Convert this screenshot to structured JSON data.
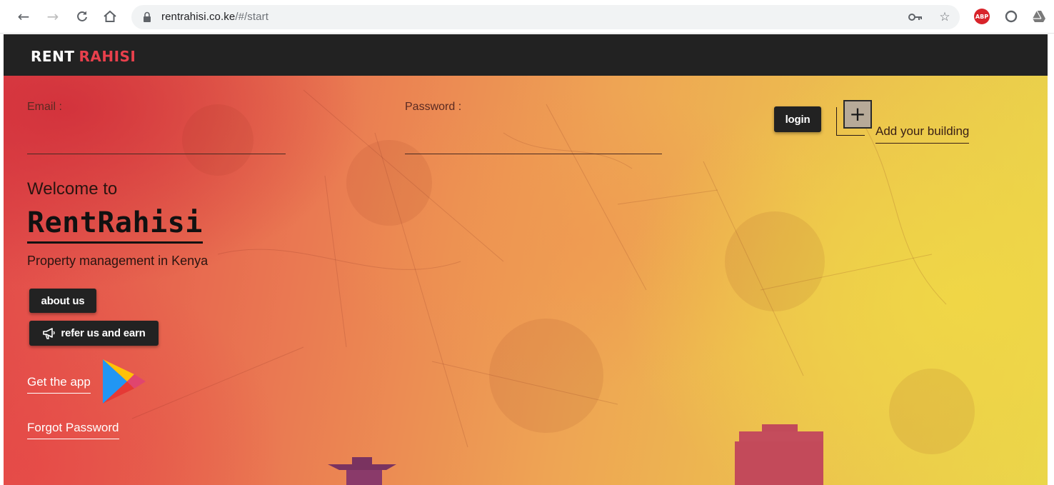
{
  "browser": {
    "url_host": "rentrahisi.co.ke",
    "url_path": "/#/start",
    "abp_label": "ABP"
  },
  "header": {
    "brand_part1": "RENT",
    "brand_part2": "RAHISI"
  },
  "login_form": {
    "email_label": "Email :",
    "email_value": "",
    "password_label": "Password :",
    "password_value": "",
    "login_button": "login"
  },
  "add_building": {
    "plus_symbol": "+",
    "link_label": "Add your building"
  },
  "hero": {
    "welcome": "Welcome to",
    "title": "RentRahisi",
    "tagline": "Property management in Kenya",
    "about_button": "about us",
    "refer_button": "refer us and earn",
    "get_app_link": "Get the app",
    "forgot_password_link": "Forgot Password"
  },
  "colors": {
    "header_bg": "#222222",
    "brand_accent": "#e8404c",
    "button_bg": "#222222"
  },
  "icons": [
    "back-arrow-icon",
    "forward-arrow-icon",
    "reload-icon",
    "home-icon",
    "lock-icon",
    "key-icon",
    "star-icon",
    "adblock-icon",
    "extension-circle-icon",
    "extension-drive-icon",
    "megaphone-icon",
    "google-play-icon",
    "plus-icon"
  ]
}
